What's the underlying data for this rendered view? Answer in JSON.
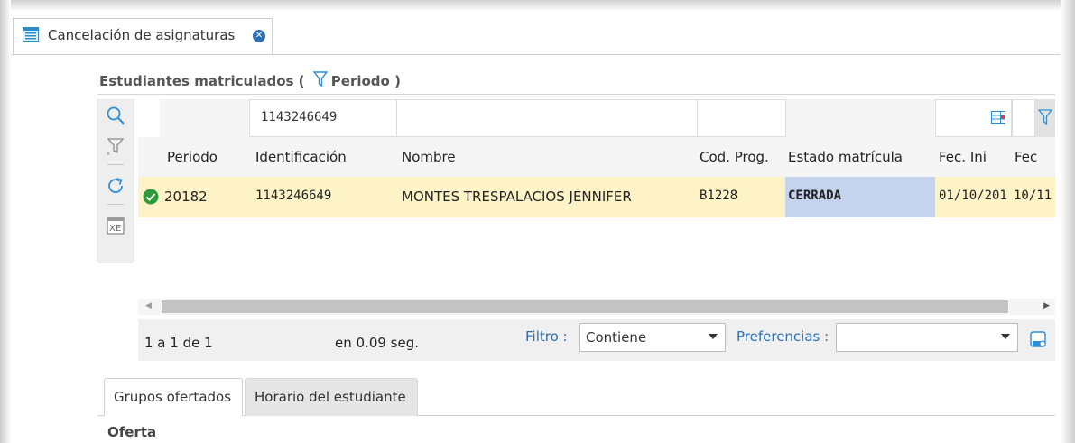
{
  "tab": {
    "label": "Cancelación de asignaturas",
    "icon": "window-list-icon",
    "close_icon": "close-circle-icon"
  },
  "section": {
    "title_prefix": "Estudiantes matriculados (",
    "filter_label": "Periodo",
    "title_suffix": ")"
  },
  "toolbar": {
    "icons": [
      "search-icon",
      "clear-filter-icon",
      "refresh-icon",
      "export-excel-icon"
    ]
  },
  "grid": {
    "filter_row": {
      "checkbox_icon": "checkbox-icon",
      "identificacion_value": "1143246649",
      "grid_icon": "grid-view-icon",
      "filter_icon": "filter-icon"
    },
    "columns": [
      "Periodo",
      "Identificación",
      "Nombre",
      "Cod. Prog.",
      "Estado matrícula",
      "Fec. Ini",
      "Fec"
    ],
    "rows": [
      {
        "status_icon": "check-circle-icon",
        "periodo": "20182",
        "identificacion": "1143246649",
        "nombre": "MONTES TRESPALACIOS JENNIFER",
        "cod_prog": "B1228",
        "estado": "CERRADA",
        "fec_ini": "01/10/201",
        "fec": "10/11"
      }
    ]
  },
  "pager": {
    "count_text": "1 a 1 de 1",
    "time_text": "en 0.09 seg.",
    "filtro_label": "Filtro :",
    "filtro_value": "Contiene",
    "preferencias_label": "Preferencias :",
    "preferencias_value": ""
  },
  "bottom_tabs": {
    "active": "Grupos ofertados",
    "inactive": "Horario del estudiante"
  },
  "subsection_title": "Oferta",
  "colors": {
    "accent": "#2f6fb3",
    "row_highlight": "#fdf3c7",
    "estado_bg": "#c5d4ee",
    "success": "#2e9b3a"
  }
}
